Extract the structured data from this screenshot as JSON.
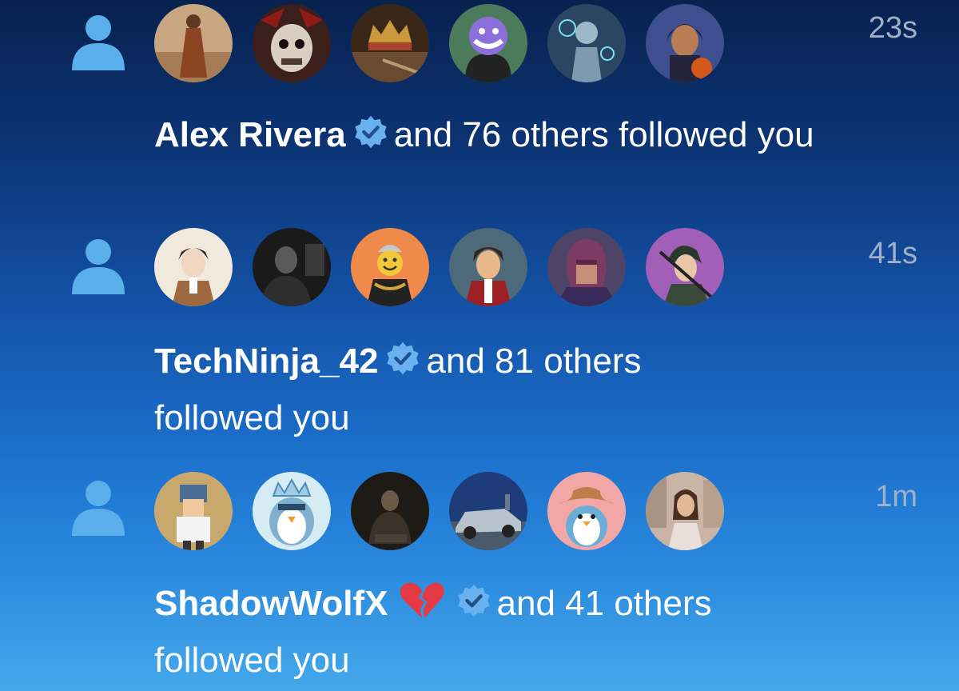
{
  "notifications": [
    {
      "name": "Alex Rivera",
      "suffix": "and 76 others followed you",
      "time": "23s",
      "avatars": [
        "monk-avatar",
        "skull-warrior-avatar",
        "crown-avatar",
        "purple-troll-avatar",
        "cyber-robot-avatar",
        "anime-character-avatar"
      ]
    },
    {
      "name": "TechNinja_42",
      "suffix": "and 81 others followed you",
      "time": "41s",
      "avatars": [
        "anime-soldier-avatar",
        "dark-photo-avatar",
        "smiley-avatar",
        "anime-boy-avatar",
        "magneto-avatar",
        "ninja-girl-avatar"
      ]
    },
    {
      "name": "ShadowWolfX",
      "suffix": "and 41 others followed you",
      "time": "1m",
      "avatars": [
        "pixel-character-avatar",
        "crown-penguin-avatar",
        "dark-figure-avatar",
        "car-avatar",
        "cowboy-penguin-avatar",
        "woman-photo-avatar"
      ]
    }
  ],
  "colors": {
    "person_icon": "#5aaee9",
    "verified_badge": "#6ab1f0",
    "timestamp": "#9fb0c8",
    "broken_heart": "#e53a44"
  }
}
